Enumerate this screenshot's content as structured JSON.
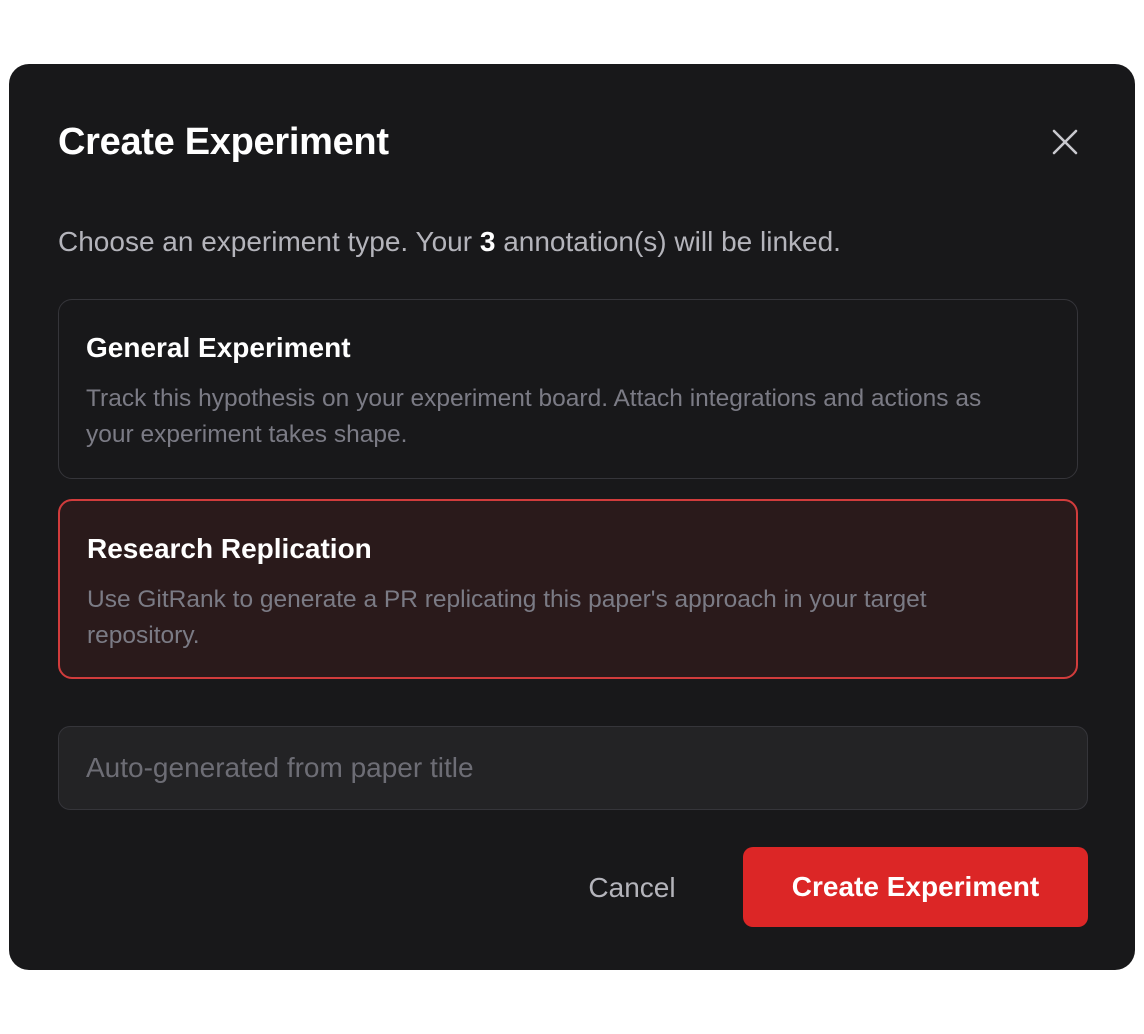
{
  "dialog": {
    "title": "Create Experiment",
    "close_icon": "close-icon",
    "description": {
      "prefix": "Choose an experiment type. Your ",
      "count": "3",
      "suffix": " annotation(s) will be linked."
    }
  },
  "options": [
    {
      "title": "General Experiment",
      "description": "Track this hypothesis on your experiment board. Attach integrations and actions as your experiment takes shape.",
      "selected": false
    },
    {
      "title": "Research Replication",
      "description": "Use GitRank to generate a PR replicating this paper's approach in your target repository.",
      "selected": true
    }
  ],
  "name_field": {
    "value": "",
    "placeholder": "Auto-generated from paper title"
  },
  "actions": {
    "cancel_label": "Cancel",
    "create_label": "Create Experiment"
  },
  "colors": {
    "modal_background": "#18181a",
    "accent": "#dc2626",
    "selected_border": "#d13c3c",
    "selected_background": "#2a1a1b",
    "muted_text": "#7b7b85"
  }
}
